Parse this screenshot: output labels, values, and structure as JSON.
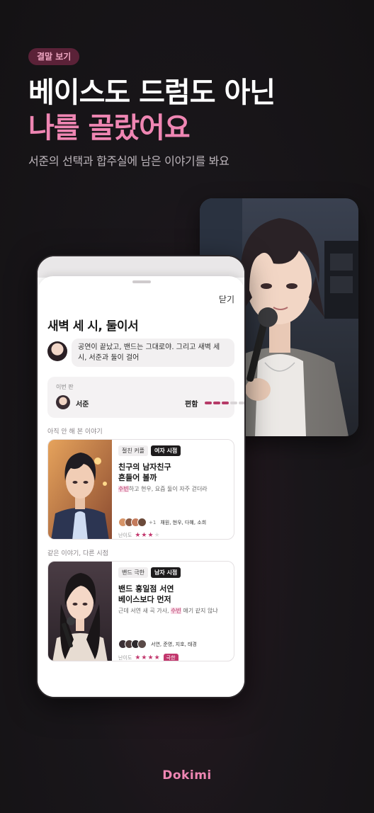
{
  "badge": "결말 보기",
  "hero": {
    "line1": "베이스도 드럼도 아닌",
    "line2": "나를 골랐어요",
    "subtitle": "서준의 선택과 합주실에 남은 이야기를 봐요"
  },
  "sheet": {
    "close_label": "닫기",
    "title": "새벽 세 시, 둘이서",
    "message": "공연이 끝났고, 밴드는 그대로야. 그리고 새벽 세 시, 서준과 둘이 걸어",
    "this_round": {
      "label": "이번 판",
      "character": "서준",
      "status": "편함",
      "level": 3,
      "level_max": 6
    },
    "unseen_section_label": "아직 안 해 본 이야기",
    "same_section_label": "같은 이야기, 다른 시점",
    "stories": [
      {
        "tag": "절친 커플",
        "pov": "여자 시점",
        "title_line1": "친구의 남자친구",
        "title_line2": "흔들어 볼까",
        "desc_highlight": "수빈",
        "desc_rest": "하고 현우, 요즘 둘이 자주 걷더라",
        "cast_more": "+1",
        "cast_names": "채원, 현우, 다혜, 소희",
        "difficulty_label": "난이도",
        "stars": 3,
        "stars_max": 4,
        "extreme": ""
      },
      {
        "tag": "밴드 극한",
        "pov": "남자 시점",
        "title_line1": "밴드 홍일점 서연",
        "title_line2": "베이스보다 먼저",
        "desc_before": "근데 서연 새 곡 가사, ",
        "desc_highlight": "수빈",
        "desc_rest": " 얘기 같지 않냐",
        "cast_names": "서연, 준영, 지호, 태경",
        "difficulty_label": "난이도",
        "stars": 4,
        "stars_max": 4,
        "extreme": "극한"
      }
    ]
  },
  "brand": "Dokimi",
  "colors": {
    "accent": "#ef86b3",
    "accent_dark": "#b53a67",
    "background": "#151315"
  }
}
